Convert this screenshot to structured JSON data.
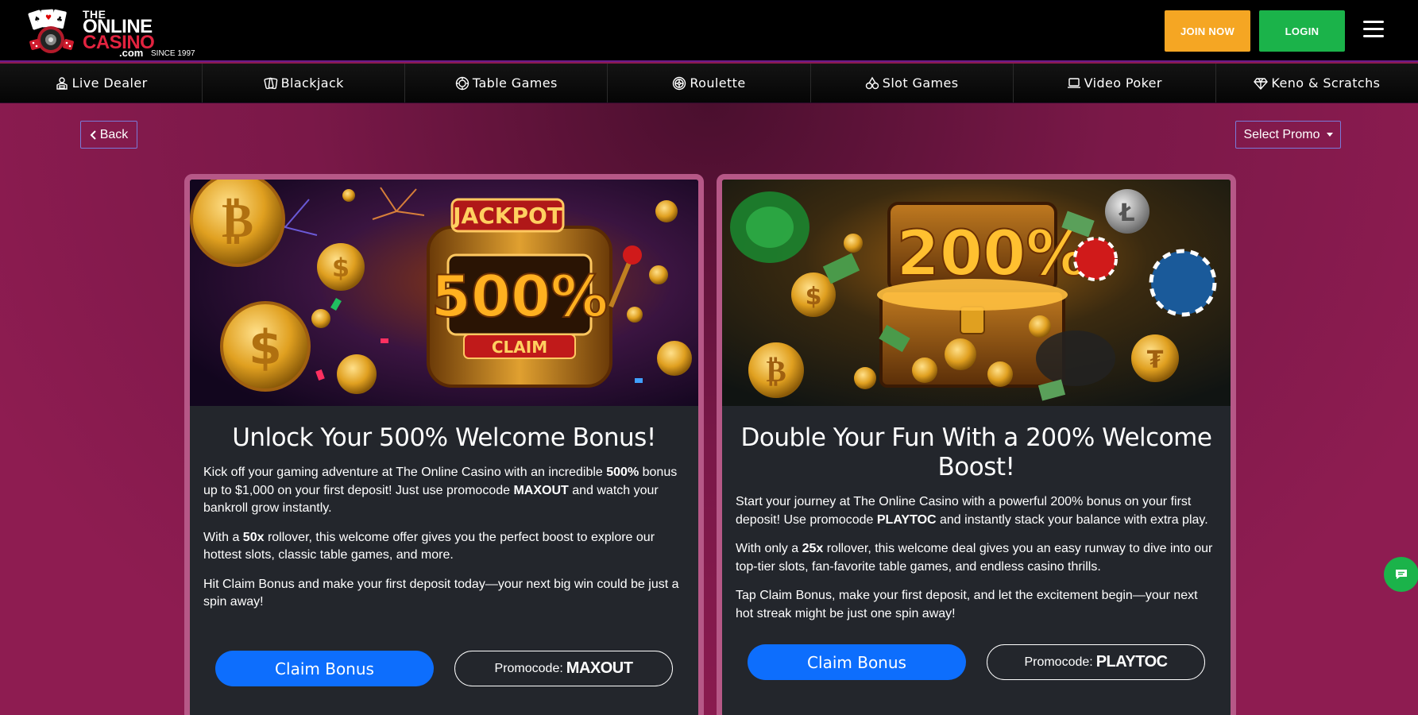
{
  "header": {
    "logo": {
      "the": "THE",
      "online": "ONLINE",
      "casino": "CASINO",
      "com": ".com",
      "since": "SINCE 1997"
    },
    "join_label": "JOIN NOW",
    "login_label": "LOGIN",
    "menu_icon": "hamburger-icon"
  },
  "nav": {
    "items": [
      {
        "label": "Live Dealer",
        "icon": "dealer-icon"
      },
      {
        "label": "Blackjack",
        "icon": "cards-icon"
      },
      {
        "label": "Table Games",
        "icon": "chip-icon"
      },
      {
        "label": "Roulette",
        "icon": "roulette-icon"
      },
      {
        "label": "Slot Games",
        "icon": "slot-icon"
      },
      {
        "label": "Video Poker",
        "icon": "laptop-icon"
      },
      {
        "label": "Keno & Scratchs",
        "icon": "diamond-icon"
      }
    ]
  },
  "toolbar": {
    "back_label": "Back",
    "promo_select_label": "Select Promo"
  },
  "cards": [
    {
      "title": "Unlock Your 500% Welcome Bonus!",
      "image_text": {
        "jackpot": "JACKPOT",
        "percent": "500%",
        "claim": "CLAIM"
      },
      "p1_a": "Kick off your gaming adventure at The Online Casino with an incredible ",
      "p1_b": "500%",
      "p1_c": " bonus up to $1,000 on your first deposit! Just use promocode ",
      "p1_d": "MAXOUT",
      "p1_e": " and watch your bankroll grow instantly.",
      "p2_a": "With a ",
      "p2_b": "50x",
      "p2_c": " rollover, this welcome offer gives you the perfect boost to explore our hottest slots, classic table games, and more.",
      "p3": "Hit Claim Bonus and make your first deposit today—your next big win could be just a spin away!",
      "claim_label": "Claim Bonus",
      "promo_prefix": "Promocode:",
      "promo_code": "MAXOUT"
    },
    {
      "title": "Double Your Fun With a 200% Welcome Boost!",
      "image_text": {
        "percent": "200%"
      },
      "p1_a": "Start your journey at The Online Casino with a powerful 200% bonus on your first deposit! Use promocode ",
      "p1_b": "PLAYTOC",
      "p1_c": " and instantly stack your balance with extra play.",
      "p2_a": "With only a ",
      "p2_b": "25x",
      "p2_c": " rollover, this welcome deal gives you an easy runway to dive into our top-tier slots, fan-favorite table games, and endless casino thrills.",
      "p3": "Tap Claim Bonus, make your first deposit, and let the excitement begin—your next hot streak might be just one spin away!",
      "claim_label": "Claim Bonus",
      "promo_prefix": "Promocode:",
      "promo_code": "PLAYTOC"
    }
  ],
  "colors": {
    "join": "#f5a623",
    "login": "#1bb34a",
    "claim": "#0d6efd",
    "page_bg": "#8c1b4f",
    "card_border": "#b65887"
  },
  "chat": {
    "icon": "chat-icon"
  }
}
